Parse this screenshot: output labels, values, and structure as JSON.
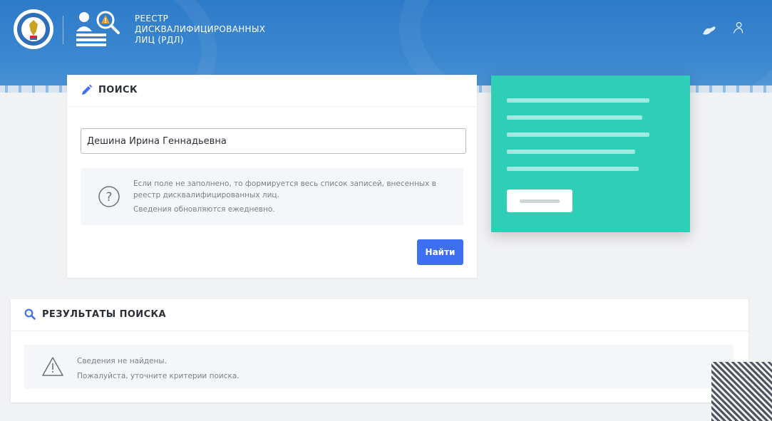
{
  "header": {
    "title_lines": [
      "РЕЕСТР",
      "ДИСКВАЛИФИЦИРОВАННЫХ",
      "ЛИЦ (РДЛ)"
    ],
    "emblem_icon": "fns-emblem-icon",
    "logo_icon": "rdl-registry-icon",
    "right_icons": [
      "hand-icon",
      "user-icon"
    ],
    "colors": {
      "primary": "#3a86cf",
      "text": "#ffffff"
    }
  },
  "search": {
    "title": "ПОИСК",
    "title_icon": "pencil-icon",
    "input_value": "Дешина Ирина Геннадьевна",
    "hint_icon": "question-circle-icon",
    "hint_line1": "Если поле не заполнено, то формируется весь список записей, внесенных в реестр дисквалифицированных лиц.",
    "hint_line2": "Сведения обновляются ежедневно.",
    "button_label": "Найти",
    "button_color": "#3d6ff0"
  },
  "promo": {
    "background_color": "#2fcfb7"
  },
  "results": {
    "title": "РЕЗУЛЬТАТЫ ПОИСКА",
    "title_icon": "search-icon",
    "warning_icon": "warning-triangle-icon",
    "message_line1": "Сведения не найдены.",
    "message_line2": "Пожалуйста, уточните критерии поиска."
  }
}
